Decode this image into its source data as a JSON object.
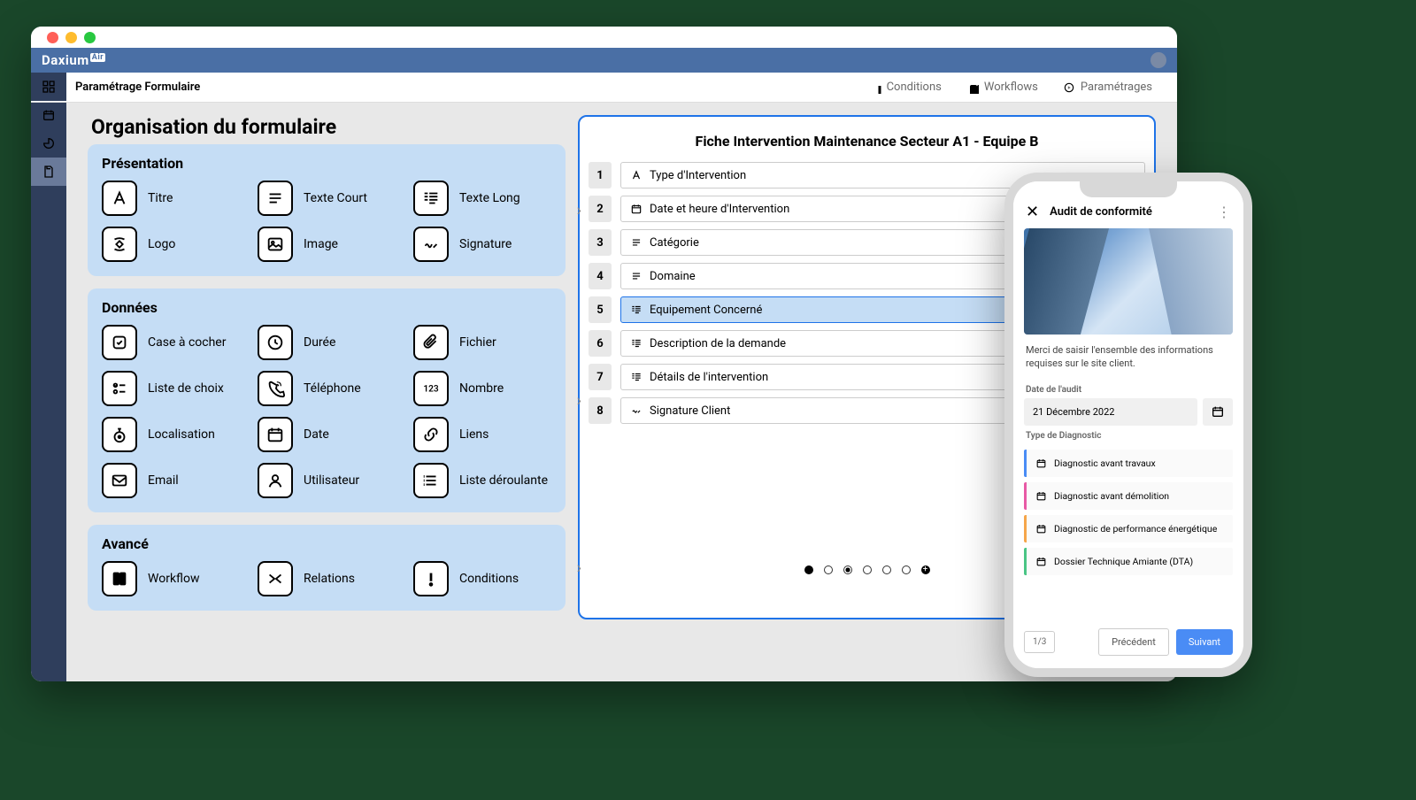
{
  "brand": "Daxium",
  "brand_badge": "Air",
  "breadcrumb": "Paramétrage Formulaire",
  "toolbar_links": {
    "conditions": "Conditions",
    "workflows": "Workflows",
    "params": "Paramétrages"
  },
  "page_title": "Organisation du formulaire",
  "groups": {
    "presentation": {
      "title": "Présentation",
      "tiles": [
        {
          "label": "Titre",
          "icon": "letter-a"
        },
        {
          "label": "Texte Court",
          "icon": "text-short"
        },
        {
          "label": "Texte Long",
          "icon": "text-long"
        },
        {
          "label": "Logo",
          "icon": "logo"
        },
        {
          "label": "Image",
          "icon": "image"
        },
        {
          "label": "Signature",
          "icon": "signature"
        }
      ]
    },
    "donnees": {
      "title": "Données",
      "tiles": [
        {
          "label": "Case à cocher",
          "icon": "checkbox"
        },
        {
          "label": "Durée",
          "icon": "clock"
        },
        {
          "label": "Fichier",
          "icon": "attachment"
        },
        {
          "label": "Liste de choix",
          "icon": "choice-list"
        },
        {
          "label": "Téléphone",
          "icon": "phone"
        },
        {
          "label": "Nombre",
          "icon": "number"
        },
        {
          "label": "Localisation",
          "icon": "location"
        },
        {
          "label": "Date",
          "icon": "date"
        },
        {
          "label": "Liens",
          "icon": "link"
        },
        {
          "label": "Email",
          "icon": "mail"
        },
        {
          "label": "Utilisateur",
          "icon": "user"
        },
        {
          "label": "Liste déroulante",
          "icon": "dropdown"
        }
      ]
    },
    "avance": {
      "title": "Avancé",
      "tiles": [
        {
          "label": "Workflow",
          "icon": "workflow"
        },
        {
          "label": "Relations",
          "icon": "relations"
        },
        {
          "label": "Conditions",
          "icon": "conditions"
        }
      ]
    }
  },
  "preview": {
    "title": "Fiche Intervention Maintenance Secteur A1 - Equipe B",
    "fields": [
      {
        "n": "1",
        "label": "Type d'Intervention",
        "icon": "letter-a"
      },
      {
        "n": "2",
        "label": "Date et heure d'Intervention",
        "icon": "date"
      },
      {
        "n": "3",
        "label": "Catégorie",
        "icon": "text-short"
      },
      {
        "n": "4",
        "label": "Domaine",
        "icon": "text-short"
      },
      {
        "n": "5",
        "label": "Equipement Concerné",
        "icon": "text-long",
        "selected": true
      },
      {
        "n": "6",
        "label": "Description de la demande",
        "icon": "text-long"
      },
      {
        "n": "7",
        "label": "Détails de l'intervention",
        "icon": "text-long"
      },
      {
        "n": "8",
        "label": "Signature Client",
        "icon": "signature"
      }
    ]
  },
  "phone": {
    "title": "Audit de conformité",
    "description": "Merci de saisir l'ensemble des informations requises sur le site client.",
    "date_label": "Date de l'audit",
    "date_value": "21 Décembre 2022",
    "diag_label": "Type de Diagnostic",
    "diagnostics": [
      {
        "label": "Diagnostic avant travaux",
        "color": "#4a8cf5"
      },
      {
        "label": "Diagnostic avant démolition",
        "color": "#e85aa5"
      },
      {
        "label": "Diagnostic de performance énergétique",
        "color": "#f5a54a"
      },
      {
        "label": "Dossier Technique Amiante (DTA)",
        "color": "#4ac585"
      }
    ],
    "page_indicator": "1/3",
    "prev": "Précédent",
    "next": "Suivant"
  }
}
